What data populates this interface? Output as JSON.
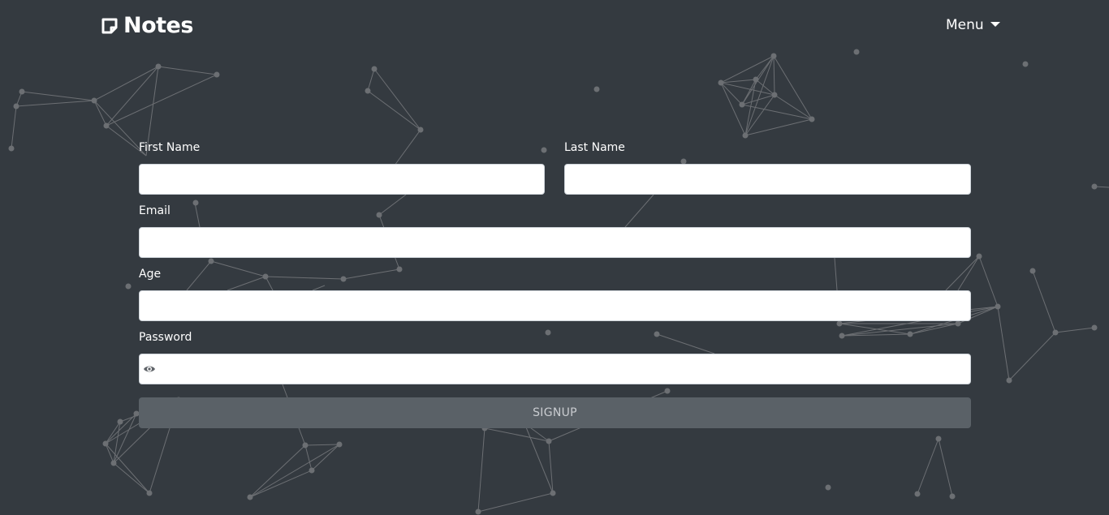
{
  "header": {
    "brand": "Notes",
    "brand_icon": "note-icon",
    "menu_label": "Menu",
    "menu_icon": "caret-down-icon"
  },
  "form": {
    "first_name": {
      "label": "First Name",
      "value": "",
      "placeholder": ""
    },
    "last_name": {
      "label": "Last Name",
      "value": "",
      "placeholder": ""
    },
    "email": {
      "label": "Email",
      "value": "",
      "placeholder": ""
    },
    "age": {
      "label": "Age",
      "value": "",
      "placeholder": ""
    },
    "password": {
      "label": "Password",
      "value": "",
      "placeholder": "",
      "toggle_icon": "eye-icon"
    },
    "submit_label": "SIGNUP"
  },
  "theme": {
    "background": "#343a40",
    "button_background": "#5a6167",
    "network_color": "#6c6f73"
  }
}
